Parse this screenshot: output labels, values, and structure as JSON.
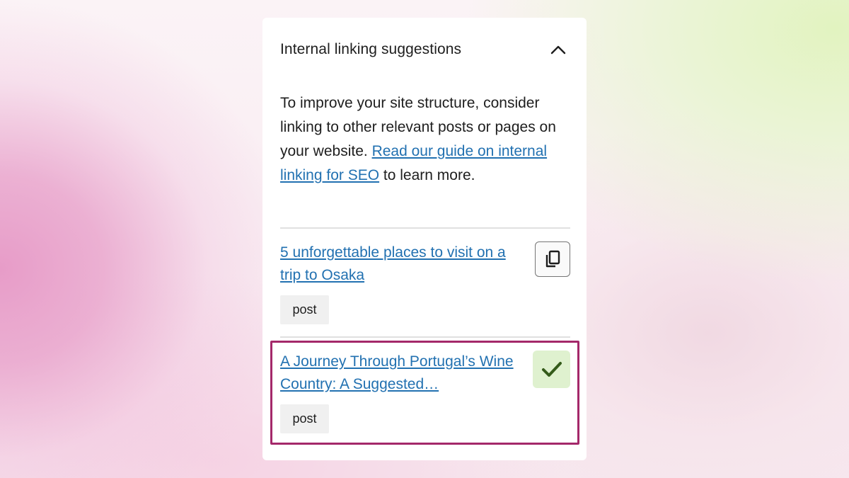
{
  "panel": {
    "title": "Internal linking suggestions",
    "collapse_icon": "chevron-up-icon",
    "description_prefix": "To improve your site structure, consider linking to other relevant posts or pages on your website. ",
    "description_link": "Read our guide on internal linking for SEO",
    "description_suffix": " to learn more."
  },
  "suggestions": [
    {
      "title": "5 unforgettable places to visit on a trip to Osaka",
      "type": "post",
      "action_icon": "copy-icon",
      "linked": false
    },
    {
      "title": "A Journey Through Portugal’s Wine Country: A Suggested…",
      "type": "post",
      "action_icon": "checkmark-icon",
      "linked": true
    }
  ],
  "colors": {
    "link": "#2271b1",
    "highlight_border": "#a4286a",
    "linked_bg": "#dff1cf",
    "check": "#345b1a",
    "tag_bg": "#f0f0f0"
  }
}
